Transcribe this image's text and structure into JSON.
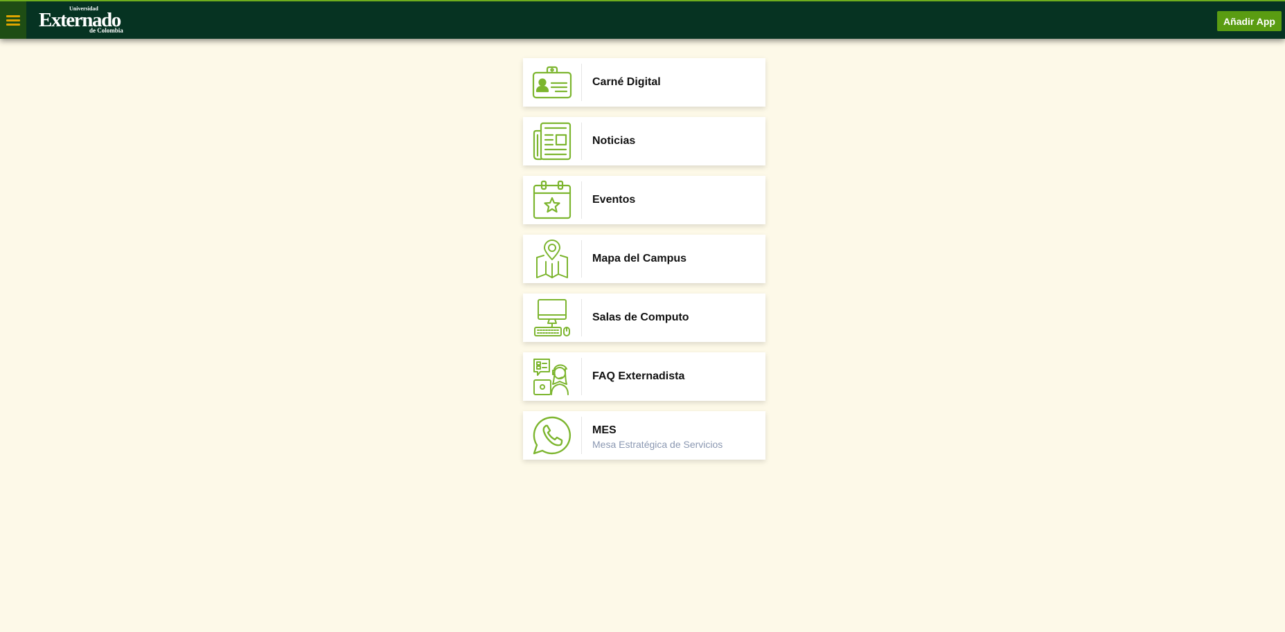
{
  "header": {
    "logo": {
      "line1": "Universidad",
      "line2": "Externado",
      "line3": "de Colombia"
    },
    "add_app_label": "Añadir App",
    "menu_icon": "hamburger-menu-icon"
  },
  "colors": {
    "header_bg": "#063322",
    "accent_green": "#7cb52e",
    "button_green": "#5a9c12",
    "page_bg": "#fdf9e8",
    "menu_icon": "#e0a500",
    "subtitle": "#8a97b1"
  },
  "cards": [
    {
      "label": "Carné Digital",
      "icon": "id-card-icon"
    },
    {
      "label": "Noticias",
      "icon": "newspaper-icon"
    },
    {
      "label": "Eventos",
      "icon": "calendar-star-icon"
    },
    {
      "label": "Mapa del Campus",
      "icon": "map-pin-icon"
    },
    {
      "label": "Salas de Computo",
      "icon": "computer-keyboard-icon"
    },
    {
      "label": "FAQ Externadista",
      "icon": "support-agent-icon"
    },
    {
      "label": "MES",
      "subtitle": "Mesa Estratégica de Servicios",
      "icon": "whatsapp-icon"
    }
  ]
}
